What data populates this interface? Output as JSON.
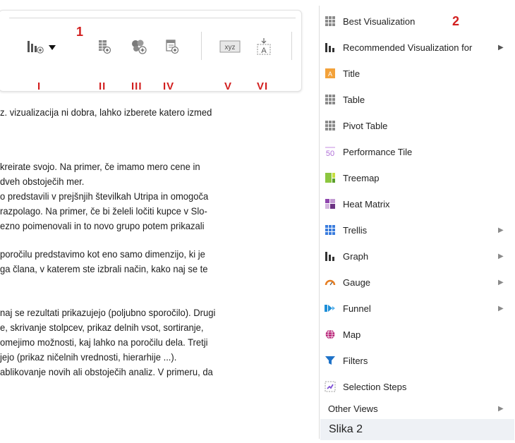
{
  "toolbar": {
    "marker": "1",
    "roman_labels": [
      "I",
      "II",
      "III",
      "IV",
      "V",
      "VI"
    ]
  },
  "text_lines": [
    "z. vizualizacija ni dobra, lahko izberete katero izmed",
    "kreirate svojo. Na primer, če imamo mero cene in",
    "dveh obstoječih mer.",
    "o predstavili v prejšnjih številkah Utripa in omogoča",
    "razpolago. Na primer, če bi želeli ločiti kupce v Slo-",
    "ezno poimenovali in to novo grupo potem prikazali",
    "poročilu predstavimo kot eno samo dimenzijo, ki je",
    "ga člana, v katerem ste izbrali način, kako naj se te",
    "naj se rezultati prikazujejo (poljubno sporočilo). Drugi",
    "e, skrivanje stolpcev, prikaz delnih vsot, sortiranje,",
    "omejimo možnosti, kaj lahko na poročilu dela. Tretji",
    "jejo (prikaz ničelnih vrednosti, hierarhije ...).",
    "ablikovanje novih ali obstoječih analiz. V primeru, da"
  ],
  "menu": {
    "marker": "2",
    "items": [
      {
        "label": "Best Visualization",
        "icon": "grid-icon",
        "submenu": false
      },
      {
        "label": "Recommended Visualization for",
        "icon": "bar-chart-icon",
        "submenu": true
      },
      {
        "label": "Title",
        "icon": "title-icon",
        "submenu": false
      },
      {
        "label": "Table",
        "icon": "table-icon",
        "submenu": false
      },
      {
        "label": "Pivot Table",
        "icon": "pivot-table-icon",
        "submenu": false
      },
      {
        "label": "Performance Tile",
        "icon": "performance-tile-icon",
        "submenu": false
      },
      {
        "label": "Treemap",
        "icon": "treemap-icon",
        "submenu": false
      },
      {
        "label": "Heat Matrix",
        "icon": "heat-matrix-icon",
        "submenu": false
      },
      {
        "label": "Trellis",
        "icon": "trellis-icon",
        "submenu": true
      },
      {
        "label": "Graph",
        "icon": "graph-icon",
        "submenu": true
      },
      {
        "label": "Gauge",
        "icon": "gauge-icon",
        "submenu": true
      },
      {
        "label": "Funnel",
        "icon": "funnel-icon",
        "submenu": true
      },
      {
        "label": "Map",
        "icon": "globe-icon",
        "submenu": false
      },
      {
        "label": "Filters",
        "icon": "filter-icon",
        "submenu": false
      },
      {
        "label": "Selection Steps",
        "icon": "selection-steps-icon",
        "submenu": false
      },
      {
        "label": "Other Views",
        "icon": "",
        "submenu": true
      }
    ],
    "caption": "Slika 2"
  },
  "colors": {
    "marker_red": "#d21f1f",
    "caption_bg": "#eef1f5"
  }
}
